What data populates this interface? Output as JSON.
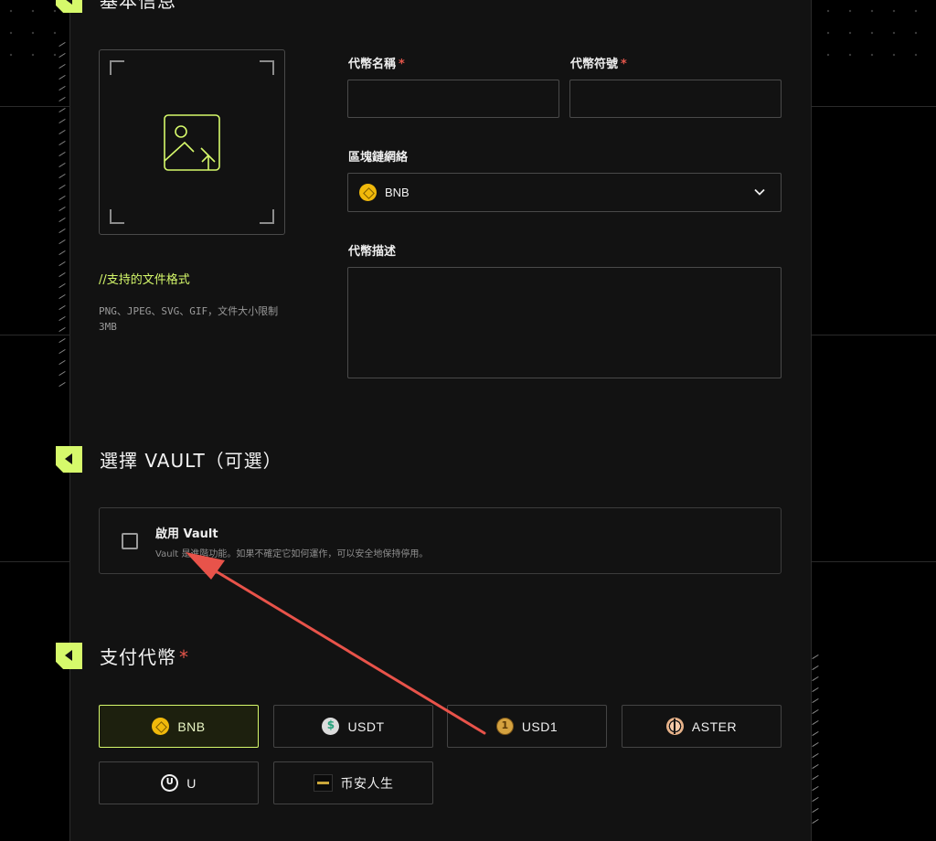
{
  "sections": {
    "basic_info": "基本信息",
    "vault": "選擇 VAULT（可選）",
    "payment": "支付代幣",
    "payment_required": "*"
  },
  "upload": {
    "formats_title": "//支持的文件格式",
    "formats_desc": "PNG、JPEG、SVG、GIF，文件大小限制 3MB"
  },
  "form": {
    "token_name_label": "代幣名稱",
    "token_symbol_label": "代幣符號",
    "required_mark": "*",
    "network_label": "區塊鏈網絡",
    "network_value": "BNB",
    "description_label": "代幣描述",
    "token_name_value": "",
    "token_symbol_value": "",
    "description_value": ""
  },
  "vault": {
    "title": "啟用 Vault",
    "desc": "Vault 是進階功能。如果不確定它如何運作，可以安全地保持停用。",
    "checked": false
  },
  "payment_tokens": [
    {
      "label": "BNB",
      "icon": "bnb-coin-icon",
      "selected": true
    },
    {
      "label": "USDT",
      "icon": "usdt-coin-icon",
      "selected": false
    },
    {
      "label": "USD1",
      "icon": "usd1-coin-icon",
      "selected": false
    },
    {
      "label": "ASTER",
      "icon": "aster-coin-icon",
      "selected": false
    },
    {
      "label": "U",
      "icon": "u-coin-icon",
      "selected": false
    },
    {
      "label": "币安人生",
      "icon": "binance-life-coin-icon",
      "selected": false
    }
  ],
  "colors": {
    "accent": "#d6f96b",
    "required": "#e5564b",
    "annotation_arrow": "#e8534a"
  }
}
